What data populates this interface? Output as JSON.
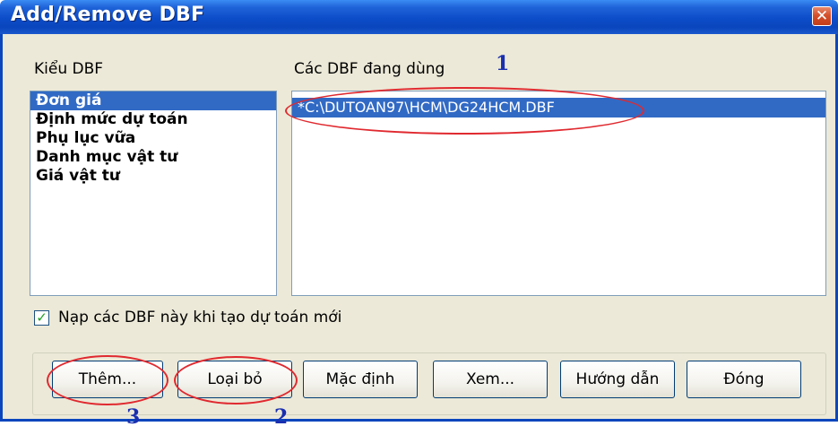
{
  "window": {
    "title": "Add/Remove DBF",
    "close_glyph": "✕"
  },
  "labels": {
    "types": "Kiểu DBF",
    "in_use": "Các DBF đang dùng"
  },
  "type_list": [
    "Đơn giá",
    "Định mức dự toán",
    "Phụ lục vữa",
    "Danh mục vật tư",
    "Giá vật tư"
  ],
  "selected_type": "Đơn giá",
  "files": [
    "*C:\\DUTOAN97\\HCM\\DG24HCM.DBF"
  ],
  "checkbox": {
    "label": "Nạp các DBF này khi tạo dự toán mới",
    "checked": true,
    "glyph": "✓"
  },
  "buttons": {
    "add": "Thêm...",
    "remove": "Loại bỏ",
    "default": "Mặc định",
    "view": "Xem...",
    "help": "Hướng dẫn",
    "close": "Đóng"
  },
  "annotations": {
    "n1": "1",
    "n2": "2",
    "n3": "3"
  },
  "colors": {
    "titlebar": "#0a46bd",
    "selection": "#316ac5",
    "annotation_ellipse": "#e0292f",
    "annotation_number": "#1a2fb0"
  }
}
